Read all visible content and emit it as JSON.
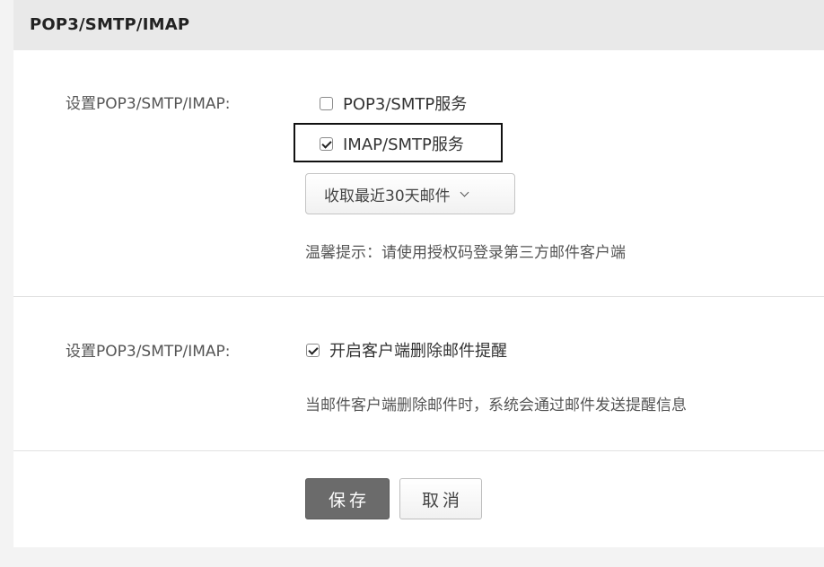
{
  "header": {
    "title": "POP3/SMTP/IMAP"
  },
  "section1": {
    "label": "设置POP3/SMTP/IMAP:",
    "options": [
      {
        "label": "POP3/SMTP服务",
        "checked": false
      },
      {
        "label": "IMAP/SMTP服务",
        "checked": true
      }
    ],
    "select": {
      "value": "收取最近30天邮件",
      "icon": "chevron-down-icon"
    },
    "hint": "温馨提示：请使用授权码登录第三方邮件客户端"
  },
  "section2": {
    "label": "设置POP3/SMTP/IMAP:",
    "option": {
      "label": "开启客户端删除邮件提醒",
      "checked": true
    },
    "hint": "当邮件客户端删除邮件时，系统会通过邮件发送提醒信息"
  },
  "actions": {
    "save_label": "保存",
    "cancel_label": "取消"
  },
  "colors": {
    "header_bg": "#e9e9e9",
    "save_button_bg": "#6b6b6b",
    "highlight_border": "#111111"
  }
}
